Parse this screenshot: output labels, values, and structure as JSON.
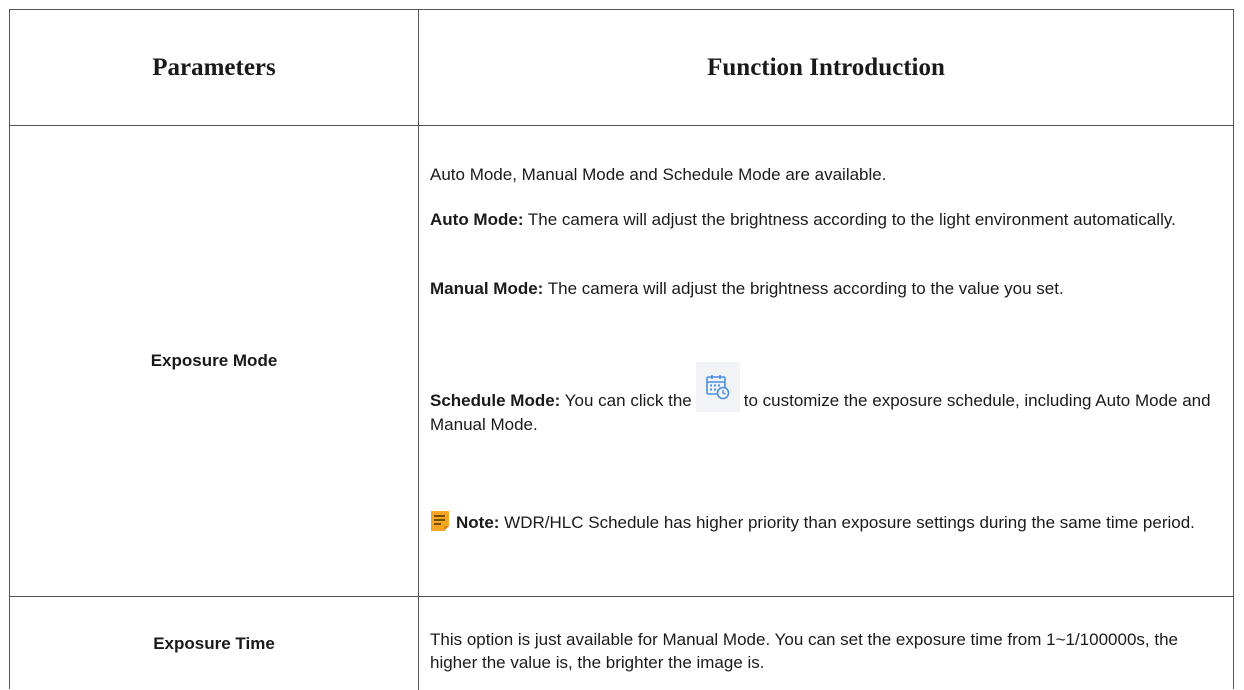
{
  "header": {
    "col1": "Parameters",
    "col2": "Function Introduction"
  },
  "rows": [
    {
      "param": "Exposure Mode",
      "intro": "Auto Mode, Manual Mode and Schedule Mode are available.",
      "auto_label": "Auto Mode:",
      "auto_text": " The camera will adjust the brightness according to the light environment automatically.",
      "manual_label": "Manual Mode:",
      "manual_text": " The camera will adjust the brightness according to the value you set.",
      "schedule_label": "Schedule Mode:",
      "schedule_text_pre": " You can click the",
      "schedule_text_post": "to customize the exposure schedule, including Auto Mode and Manual Mode.",
      "note_label": "Note:",
      "note_text": "  WDR/HLC Schedule has higher priority than exposure settings during the same time period.",
      "icons": [
        "schedule-calendar-icon",
        "note-icon"
      ]
    },
    {
      "param": "Exposure Time",
      "text": "This option is just available for Manual Mode. You can set the exposure time from 1~1/100000s, the higher the value is, the brighter the image is."
    }
  ],
  "colors": {
    "border": "#555555",
    "icon_blue": "#4a8fe0",
    "note_orange": "#f5a623"
  }
}
